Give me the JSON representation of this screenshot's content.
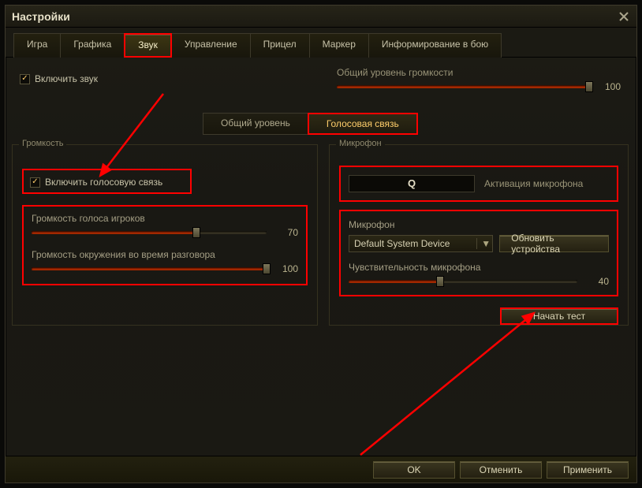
{
  "window": {
    "title": "Настройки"
  },
  "tabs": [
    "Игра",
    "Графика",
    "Звук",
    "Управление",
    "Прицел",
    "Маркер",
    "Информирование в бою"
  ],
  "active_tab_index": 2,
  "enable_sound": {
    "label": "Включить звук",
    "checked": true
  },
  "overall": {
    "label": "Общий уровень громкости",
    "value": 100
  },
  "subtabs": {
    "general": "Общий уровень",
    "voice": "Голосовая связь",
    "active": "voice"
  },
  "volume": {
    "legend": "Громкость",
    "enable_voice": {
      "label": "Включить голосовую связь",
      "checked": true
    },
    "players": {
      "label": "Громкость голоса игроков",
      "value": 70
    },
    "ambient": {
      "label": "Громкость окружения во время разговора",
      "value": 100
    }
  },
  "mic": {
    "legend": "Микрофон",
    "key": {
      "value": "Q",
      "label": "Активация микрофона"
    },
    "device_legend": "Микрофон",
    "device": "Default System Device",
    "refresh": "Обновить устройства",
    "sensitivity": {
      "label": "Чувствительность микрофона",
      "value": 40
    },
    "start_test": "Начать тест"
  },
  "footer": {
    "ok": "OK",
    "cancel": "Отменить",
    "apply": "Применить"
  }
}
